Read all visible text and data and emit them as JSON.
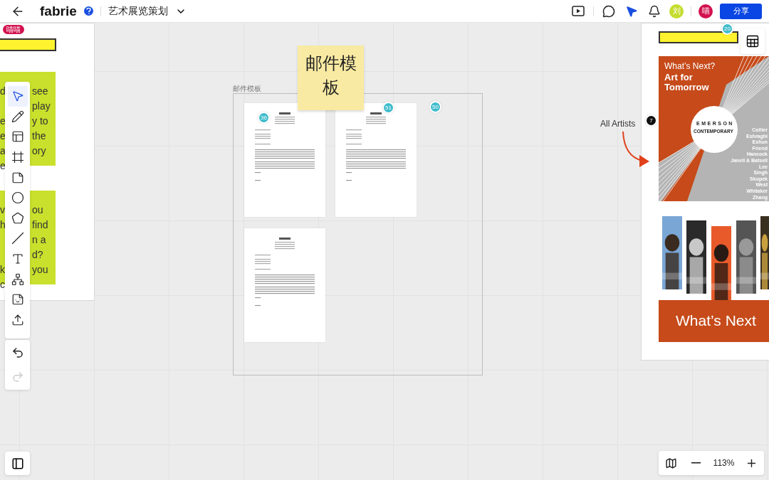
{
  "topbar": {
    "app_name": "fabrie",
    "board_title": "艺术展览策划",
    "avatars": [
      {
        "initial": "刘",
        "color": "#c5dc2e"
      },
      {
        "initial": "喵",
        "color": "#d2124e"
      }
    ],
    "share_button": "分享"
  },
  "left_board": {
    "user_tag": "喵喵",
    "stickies": [
      {
        "lines": [
          {
            "left": "d",
            "right": "see"
          },
          {
            "right": "play"
          },
          {
            "left": "e",
            "right": "y to"
          },
          {
            "left": "e",
            "right": "the"
          },
          {
            "left": "a",
            "right": "ory"
          },
          {
            "left": "e"
          }
        ]
      },
      {
        "lines": [
          {
            "left": "v",
            "right": "ou"
          },
          {
            "left": "h",
            "right": "find"
          },
          {
            "right": "n a"
          },
          {
            "right": "d?"
          },
          {
            "left": "k",
            "right": "you"
          },
          {
            "left": "c"
          }
        ]
      }
    ]
  },
  "toolbar": {
    "tools": [
      {
        "kind": "select",
        "selected": true
      },
      {
        "kind": "pen",
        "selected": false
      },
      {
        "kind": "template",
        "selected": false
      },
      {
        "kind": "frame",
        "selected": false
      },
      {
        "kind": "sticky",
        "selected": false
      },
      {
        "kind": "circle",
        "selected": false
      },
      {
        "kind": "pentagon",
        "selected": false
      },
      {
        "kind": "line",
        "selected": false
      },
      {
        "kind": "text",
        "selected": false
      },
      {
        "kind": "mindmap",
        "selected": false
      },
      {
        "kind": "sticker",
        "selected": false
      },
      {
        "kind": "upload",
        "selected": false
      }
    ]
  },
  "history": {
    "undo": {
      "disabled": false
    },
    "redo": {
      "disabled": true
    }
  },
  "frame": {
    "label": "邮件模板",
    "pages": [
      {
        "kind": "letter",
        "badge": "36"
      },
      {
        "kind": "letter",
        "badge": "51"
      },
      {
        "kind": "letter"
      }
    ],
    "badge": "50"
  },
  "sticky_note": {
    "text": "邮件模板"
  },
  "annotation": {
    "label": "All Artists",
    "badge": "7"
  },
  "right_board": {
    "badge": "20",
    "poster": {
      "kicker": "What’s Next?",
      "title_lines": [
        "Art for",
        "Tomorrow"
      ],
      "logo_top": "EMERSON",
      "logo_bottom": "CONTEMPORARY",
      "artists": [
        "Collier",
        "Eshraghi",
        "Eshun",
        "Friend",
        "Hancock",
        "Janell & Batsell",
        "Lee",
        "Singh",
        "Skopek",
        "West",
        "Whitaker",
        "Zhang"
      ]
    },
    "banner": "What’s Next"
  },
  "zoom": {
    "level": "113%"
  }
}
